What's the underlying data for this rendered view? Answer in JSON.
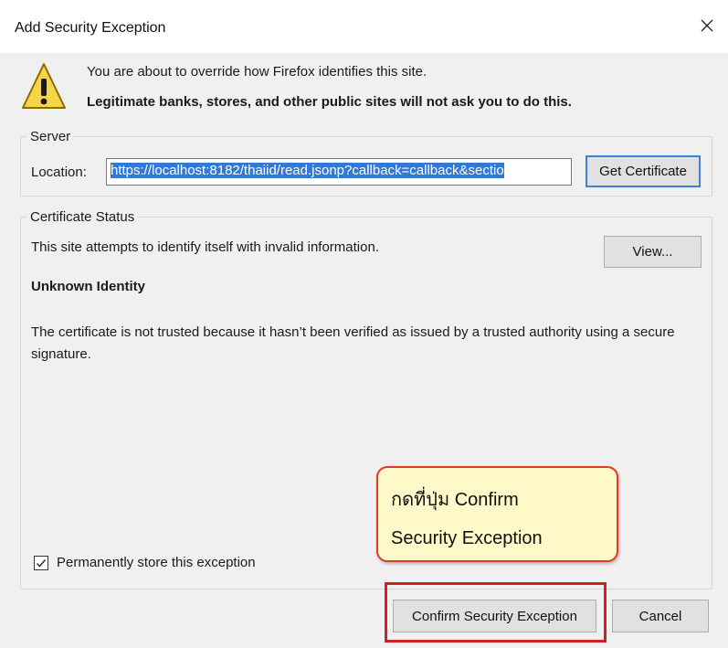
{
  "dialog": {
    "title": "Add Security Exception",
    "close_icon": "close-icon"
  },
  "warning": {
    "icon": "warning-icon",
    "line1": "You are about to override how Firefox identifies this site.",
    "line2": "Legitimate banks, stores, and other public sites will not ask you to do this."
  },
  "server": {
    "legend": "Server",
    "location_label": "Location:",
    "location_value": "https://localhost:8182/thaiid/read.jsonp?callback=callback&sectio",
    "get_certificate_label": "Get Certificate"
  },
  "certificate_status": {
    "legend": "Certificate Status",
    "status_text": "This site attempts to identify itself with invalid information.",
    "view_label": "View...",
    "identity_heading": "Unknown Identity",
    "description": "The certificate is not trusted because it hasn’t been verified as issued by a trusted authority using a secure signature."
  },
  "annotation": {
    "line1": "กดที่ปุ่ม Confirm",
    "line2": "Security Exception"
  },
  "options": {
    "permanent_label": "Permanently store this exception",
    "permanent_checked": true
  },
  "buttons": {
    "confirm_label": "Confirm Security Exception",
    "cancel_label": "Cancel"
  },
  "colors": {
    "selection": "#3478d6",
    "focus_border": "#3b82d6",
    "highlight_red": "#d21f1f",
    "callout_fill": "#fff8c8"
  }
}
